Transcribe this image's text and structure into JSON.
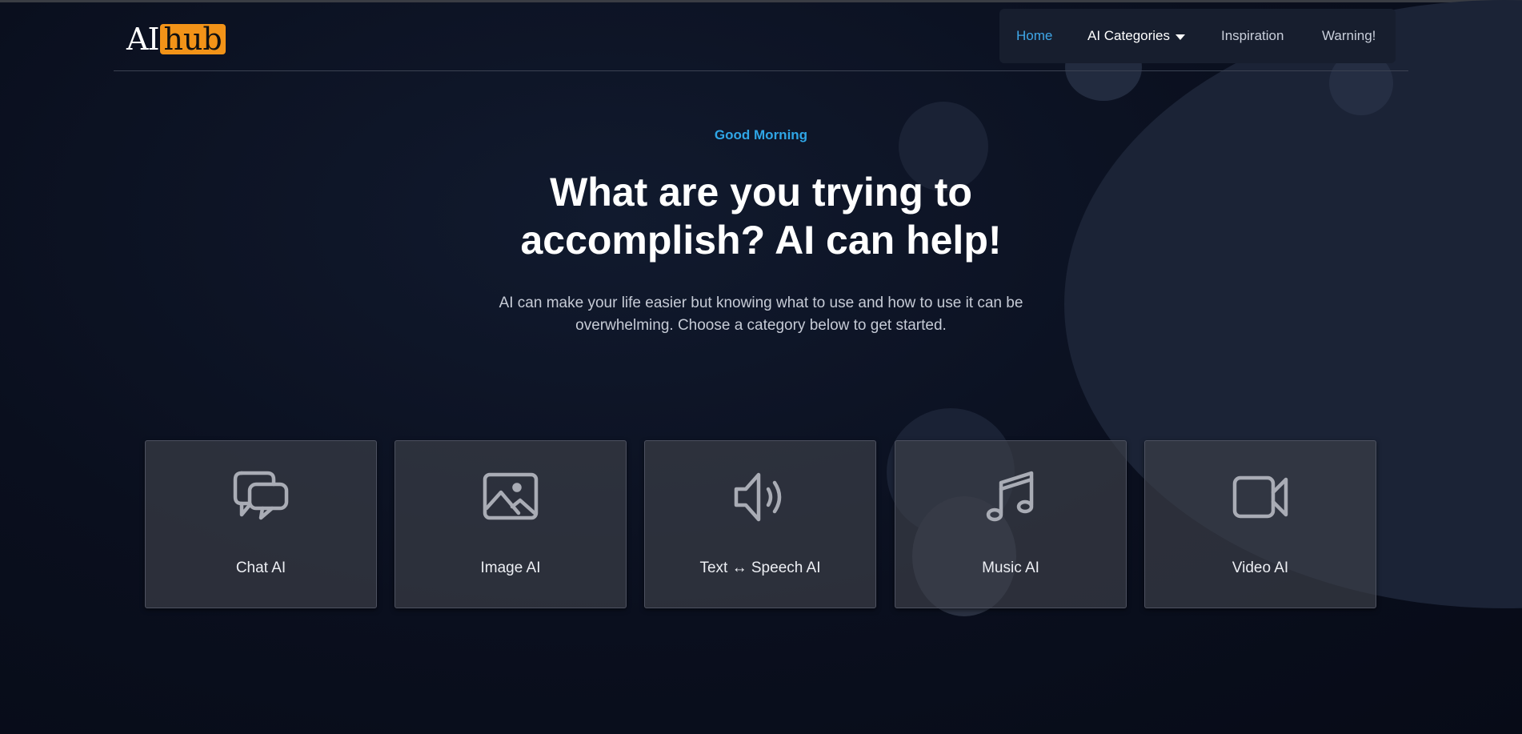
{
  "logo": {
    "prefix": "AI",
    "highlight": "hub"
  },
  "nav": {
    "home": "Home",
    "categories": "AI Categories",
    "inspiration": "Inspiration",
    "warning": "Warning!"
  },
  "hero": {
    "greeting": "Good Morning",
    "headline": "What are you trying to accomplish? AI can help!",
    "subtext": "AI can make your life easier but knowing what to use and how to use it can be overwhelming. Choose a category below to get started."
  },
  "categories": [
    {
      "label": "Chat AI",
      "icon": "chat-bubbles-icon"
    },
    {
      "label": "Image AI",
      "icon": "image-icon"
    },
    {
      "label": "Text ↔ Speech AI",
      "icon": "speaker-icon"
    },
    {
      "label": "Music AI",
      "icon": "music-note-icon"
    },
    {
      "label": "Video AI",
      "icon": "video-camera-icon"
    }
  ],
  "colors": {
    "accent": "#2fa6e6",
    "logo_highlight": "#f29318",
    "background": "#0b1020"
  }
}
